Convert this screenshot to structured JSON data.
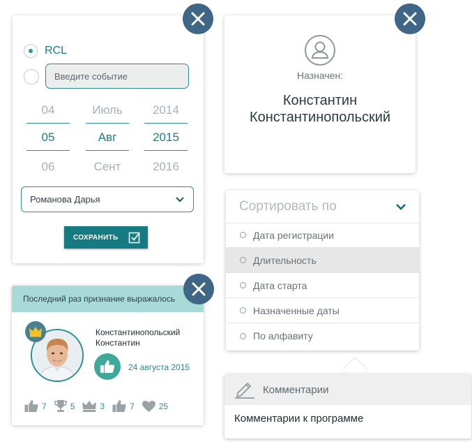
{
  "event_card": {
    "radio_option_1": "RCL",
    "event_input_placeholder": "Введите событие",
    "date_picker": {
      "day": {
        "prev": "04",
        "selected": "05",
        "next": "06"
      },
      "month": {
        "prev": "Июль",
        "selected": "Авг",
        "next": "Сент"
      },
      "year": {
        "prev": "2014",
        "selected": "2015",
        "next": "2016"
      }
    },
    "person_select_value": "Романова Дарья",
    "save_label": "СОХРАНИТЬ"
  },
  "assigned_card": {
    "label": "Назначен:",
    "name_line1": "Константин",
    "name_line2": "Константинопольский"
  },
  "sort_dropdown": {
    "title": "Сортировать по",
    "options": [
      {
        "label": "Дата регистрации"
      },
      {
        "label": "Длительность",
        "active": true
      },
      {
        "label": "Дата старта"
      },
      {
        "label": "Назначенные даты"
      },
      {
        "label": "По алфавиту"
      }
    ]
  },
  "recognition_card": {
    "header": "Последний раз признание выражалось",
    "name_line1": "Константинопольский",
    "name_line2": "Константин",
    "date": "24 августа 2015",
    "stats": [
      {
        "icon": "thumbs-up-icon",
        "value": "7"
      },
      {
        "icon": "trophy-icon",
        "value": "5"
      },
      {
        "icon": "crown-icon",
        "value": "3"
      },
      {
        "icon": "thumbs-up-icon",
        "value": "7"
      },
      {
        "icon": "heart-icon",
        "value": "25"
      }
    ]
  },
  "comments_card": {
    "title": "Комментарии",
    "body": "Комментарии к программе"
  },
  "colors": {
    "accent": "#157b81",
    "close_button": "#3f6587",
    "header_teal": "#a8dbd8"
  }
}
